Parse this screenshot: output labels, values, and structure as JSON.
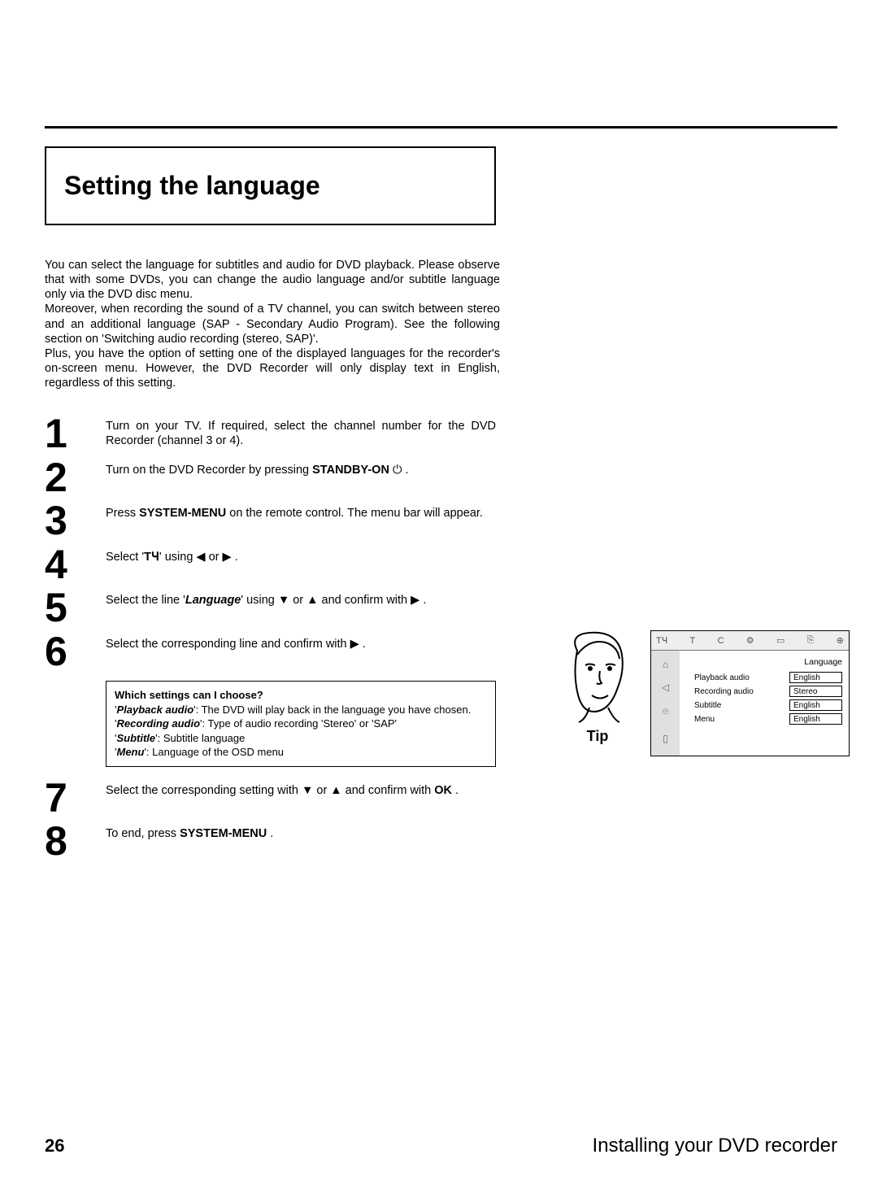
{
  "section_title": "Setting the language",
  "intro": {
    "p1": "You can select the language for subtitles and audio for DVD playback. Please observe that with some DVDs, you can change the audio language and/or subtitle language only via the DVD disc menu.",
    "p2": "Moreover, when recording the sound of a TV channel, you can switch between stereo and an additional language (SAP - Secondary Audio Program). See the following section on 'Switching audio recording (stereo, SAP)'.",
    "p3": "Plus, you have the option of setting one of the displayed languages for the recorder's on-screen menu. However, the DVD Recorder will only display text in English, regardless of this setting."
  },
  "steps": [
    {
      "n": "1",
      "pre": "Turn on your TV. If required, select the channel number for the DVD Recorder (channel 3 or 4).",
      "bold": "",
      "post": ""
    },
    {
      "n": "2",
      "pre": "Turn on the DVD Recorder by pressing ",
      "bold": "STANDBY-ON",
      "post": " ⏻ ."
    },
    {
      "n": "3",
      "pre": "Press ",
      "bold": "SYSTEM-MENU",
      "post": " on the remote control. The menu bar will appear."
    },
    {
      "n": "4",
      "pre": "Select '",
      "bold": "",
      "post": "' using  ◀  or  ▶ .",
      "icon_text": "TꞍ"
    },
    {
      "n": "5",
      "pre": "Select the line '",
      "emph": "Language",
      "post": "' using  ▼  or  ▲  and confirm with  ▶ ."
    },
    {
      "n": "6",
      "pre": "Select the corresponding line and confirm with  ▶ .",
      "bold": "",
      "post": ""
    },
    {
      "n": "7",
      "pre": "Select the corresponding setting with  ▼  or  ▲  and confirm with ",
      "bold": "OK",
      "post": " ."
    },
    {
      "n": "8",
      "pre": "To end, press ",
      "bold": "SYSTEM-MENU",
      "post": " ."
    }
  ],
  "tip": {
    "heading": "Which settings can I choose?",
    "items": [
      {
        "name": "Playback audio",
        "desc": ": The DVD will play back in the language you have chosen."
      },
      {
        "name": "Recording audio",
        "desc": ": Type of audio recording 'Stereo' or 'SAP'"
      },
      {
        "name": "Subtitle",
        "desc": ": Subtitle language"
      },
      {
        "name": "Menu",
        "desc": ": Language of the OSD menu"
      }
    ],
    "label": "Tip"
  },
  "osd": {
    "heading": "Language",
    "rows": [
      {
        "label": "Playback audio",
        "value": "English"
      },
      {
        "label": "Recording audio",
        "value": "Stereo"
      },
      {
        "label": "Subtitle",
        "value": "English"
      },
      {
        "label": "Menu",
        "value": "English"
      }
    ],
    "top_icons": [
      "TꞍ",
      "T",
      "C",
      "⚙",
      "▭",
      "⎘",
      "⊕"
    ],
    "side_icons": [
      "⌂",
      "◁",
      "⯐",
      "▯"
    ]
  },
  "footer": {
    "page": "26",
    "title": "Installing your DVD recorder"
  }
}
